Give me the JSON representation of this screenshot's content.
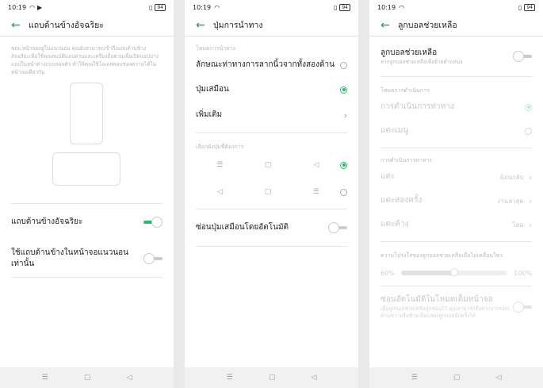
{
  "status": {
    "time": "10:19",
    "battery": "94"
  },
  "screens": {
    "sidebar": {
      "title": "แถบด้านข้างอัจฉริยะ",
      "description": "ขณะหน้าจออยู่ในแนวนอน คุณยังสามารถเข้าถึงแถบด้านข้างอัจฉริยะเพื่อใช้คุณสมบัติแอปด่วนและเครื่องมือด่วนเพื่อเปิดแอปบางแอปในหน้าต่างแบบลอยตัว ทำให้คุณใช้โอเอสคอบช่องความได้ในหน้าจอเดียวกัน",
      "toggle1_label": "แถบด้านข้างอัจฉริยะ",
      "toggle1_state": "on",
      "toggle2_label": "ใช้แถบด้านข้างในหน้าจอแนวนอนเท่านั้น",
      "toggle2_state": "off"
    },
    "navigation": {
      "title": "ปุ่มการนำทาง",
      "section_mode": "โหมดการนำทาง",
      "option1": "ลักษณะท่าทางการลากนิ้วจากทั้งสองด้าน",
      "option2": "ปุ่มเสมือน",
      "option3": "เพิ่มเติม",
      "selected_option": "ปุ่มเสมือน",
      "section_layout": "เลือกผังปุ่มที่ต้องการ",
      "auto_hide_label": "ซ่อนปุ่มเสมือนโดยอัตโนมัติ",
      "auto_hide_state": "off"
    },
    "assistive_ball": {
      "title": "ลูกบอลช่วยเหลือ",
      "toggle_label": "ลูกบอลช่วยเหลือ",
      "toggle_sub": "ลากลูกบอลช่วยเหลือเพื่อย้ายตำแหน่ง",
      "toggle_state": "off",
      "section_mode": "โหมดการดำเนินการ",
      "mode1": "การดำเนินการท่าทาง",
      "mode2": "แตะเมนู",
      "section_gesture": "การดำเนินการท่าทาง",
      "tap_label": "แตะ",
      "tap_value": "ย้อนกลับ",
      "double_tap_label": "แตะสองครั้ง",
      "double_tap_value": "งานล่าสุด",
      "long_press_label": "แตะค้าง",
      "long_press_value": "โฮม",
      "opacity_label": "ความโปร่งใสของลูกบอลช่วยเหลือเมื่อไม่เคลื่อนไหว",
      "opacity_min": "60%",
      "opacity_max": "100%",
      "opacity_level": 0.5,
      "auto_hide_label": "ซ่อนอัตโนมัติในโหมดเต็มหน้าจอ",
      "auto_hide_sub": "เมื่อลูกบอลช่วยเหลือถูกซ่อนไว้ คุณสามารถดึงลากจากขอบด้านขวาหรือซ้ายเพื่อแสดงลูกบอลอีกครั้งได้"
    }
  },
  "colors": {
    "accent": "#1fbf6b"
  },
  "icons": [
    "back-arrow-icon",
    "menu-icon",
    "home-icon",
    "back-icon"
  ]
}
